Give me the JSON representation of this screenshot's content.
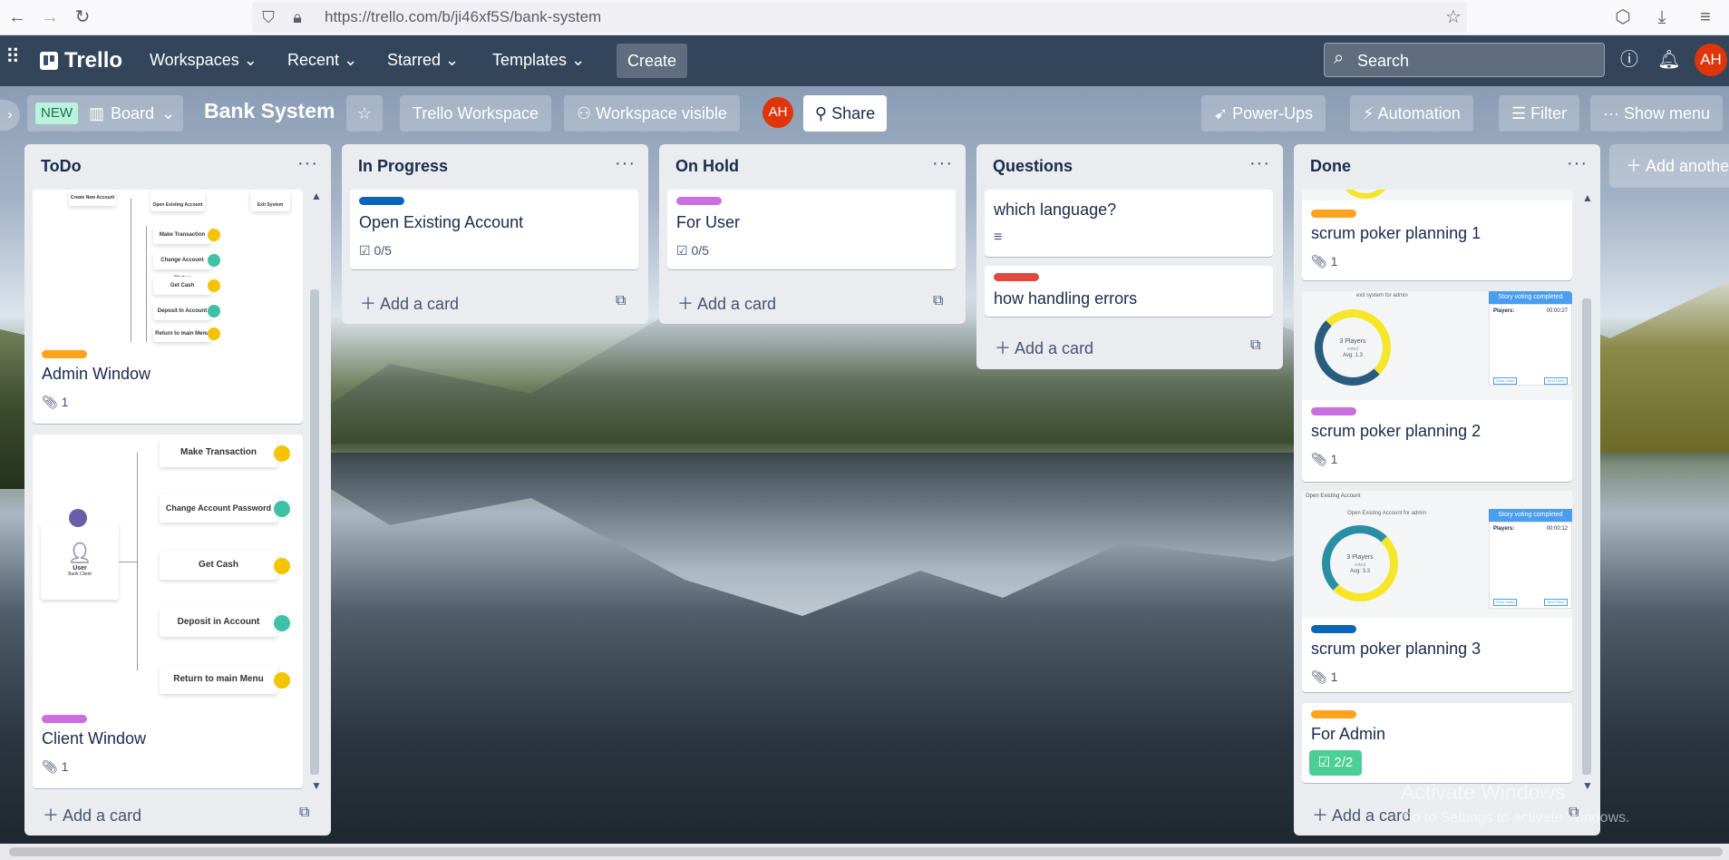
{
  "browser": {
    "url": "https://trello.com/b/ji46xf5S/bank-system"
  },
  "nav": {
    "logo": "Trello",
    "workspaces": "Workspaces",
    "recent": "Recent",
    "starred": "Starred",
    "templates": "Templates",
    "create": "Create",
    "search_placeholder": "Search",
    "avatar_initials": "AH"
  },
  "board": {
    "new_badge": "NEW",
    "view_label": "Board",
    "title": "Bank System",
    "workspace": "Trello Workspace",
    "visibility": "Workspace visible",
    "member_initials": "AH",
    "share": "Share",
    "power_ups": "Power-Ups",
    "automation": "Automation",
    "filter": "Filter",
    "show_menu": "Show menu",
    "add_another_list": "Add another list"
  },
  "lists": [
    {
      "title": "ToDo",
      "cards": [
        {
          "title": "Admin Window",
          "label_color": "#ffa21c",
          "attachments": "1",
          "cover_texts": [
            "Create New Account",
            "Open Existing Account",
            "Exit System",
            "Make Transaction",
            "Change Account Status",
            "Get Cash",
            "Deposit In Account",
            "Return to main Menu"
          ]
        },
        {
          "title": "Client Window",
          "label_color": "#c96fe0",
          "attachments": "1",
          "cover_texts": [
            "Make Transaction",
            "Change Account Password",
            "Get Cash",
            "Deposit in Account",
            "Return to main Menu",
            "User",
            "Bank Client"
          ]
        }
      ],
      "add_card": "Add a card"
    },
    {
      "title": "In Progress",
      "cards": [
        {
          "title": "Open Existing Account",
          "label_color": "#0c66b8",
          "checklist": "0/5"
        }
      ],
      "add_card": "Add a card"
    },
    {
      "title": "On Hold",
      "cards": [
        {
          "title": "For User",
          "label_color": "#c96fe0",
          "checklist": "0/5"
        }
      ],
      "add_card": "Add a card"
    },
    {
      "title": "Questions",
      "cards": [
        {
          "title": "which language?"
        },
        {
          "title": "how handling errors",
          "label_color": "#e2483d"
        }
      ],
      "add_card": "Add a card"
    },
    {
      "title": "Done",
      "cards": [
        {
          "title": "scrum poker planning 1",
          "label_color": "#ffa21c",
          "attachments": "1"
        },
        {
          "title": "scrum poker planning 2",
          "label_color": "#c96fe0",
          "attachments": "1",
          "cover_texts": [
            "exit system for admin",
            "Story voting completed",
            "Players:",
            "00:00:27",
            "3 Players",
            "voted",
            "Avg: 1.3",
            "Clear Votes",
            "Next Story"
          ]
        },
        {
          "title": "scrum poker planning 3",
          "label_color": "#0c66b8",
          "attachments": "1",
          "cover_texts": [
            "Open Existing Account",
            "Open Existing Account for admin",
            "Story voting completed",
            "Players:",
            "00:00:12",
            "3 Players",
            "voted",
            "Avg: 3.3",
            "Clear Votes",
            "Next Story"
          ]
        },
        {
          "title": "For Admin",
          "label_color": "#ffa21c",
          "checklist": "2/2"
        }
      ],
      "add_card": "Add a card"
    }
  ],
  "watermark": {
    "line1": "Activate Windows",
    "line2": "Go to Settings to activate Windows."
  }
}
